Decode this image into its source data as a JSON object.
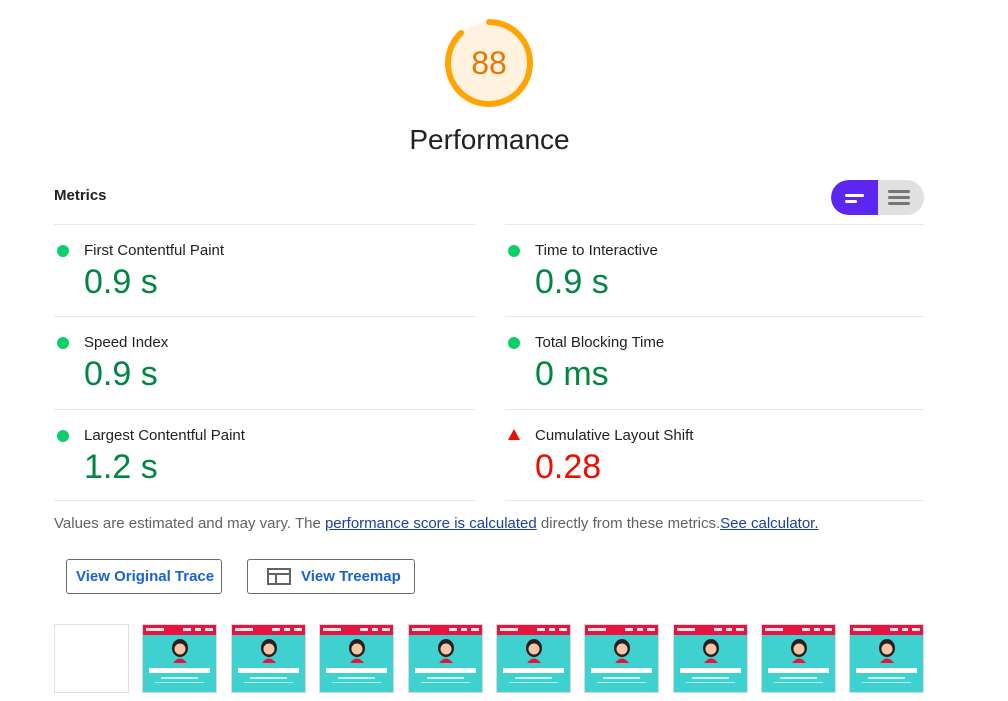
{
  "score": {
    "value": "88",
    "fraction": 0.88,
    "title": "Performance",
    "color": "#ffa400"
  },
  "metrics_header": "Metrics",
  "metrics": [
    {
      "label": "First Contentful Paint",
      "value": "0.9 s",
      "status": "pass"
    },
    {
      "label": "Time to Interactive",
      "value": "0.9 s",
      "status": "pass"
    },
    {
      "label": "Speed Index",
      "value": "0.9 s",
      "status": "pass"
    },
    {
      "label": "Total Blocking Time",
      "value": "0 ms",
      "status": "pass"
    },
    {
      "label": "Largest Contentful Paint",
      "value": "1.2 s",
      "status": "pass"
    },
    {
      "label": "Cumulative Layout Shift",
      "value": "0.28",
      "status": "fail"
    }
  ],
  "note": {
    "prefix": "Values are estimated and may vary. The ",
    "link1": "performance score is calculated",
    "middle": " directly from these metrics.",
    "link2": "See calculator."
  },
  "buttons": {
    "trace": "View Original Trace",
    "treemap": "View Treemap"
  },
  "colors": {
    "pass": "#0cce6b",
    "fail": "#eb0f00",
    "accent": "#5c26f0",
    "average": "#ffa400"
  },
  "icons": {
    "toggle_left": "compact-view-icon",
    "toggle_right": "list-view-icon",
    "treemap": "treemap-icon"
  }
}
